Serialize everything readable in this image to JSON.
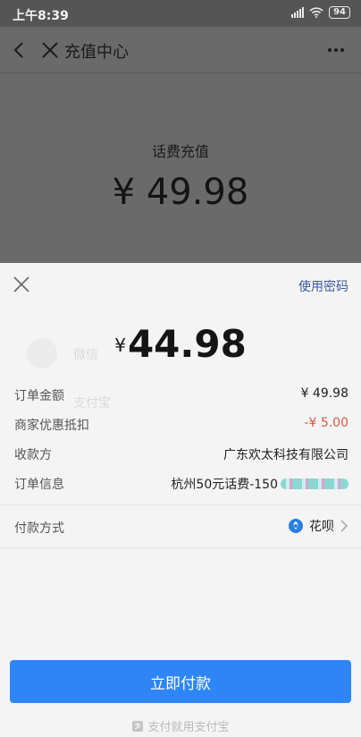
{
  "status_bar": {
    "time": "上午8:39",
    "battery": "94"
  },
  "nav": {
    "title": "充值中心"
  },
  "recharge": {
    "label": "话费充值",
    "amount": "¥ 49.98"
  },
  "sheet": {
    "use_password": "使用密码",
    "amount_currency": "¥",
    "amount_value": "44.98",
    "rows": [
      {
        "label": "订单金额",
        "value": "¥ 49.98"
      },
      {
        "label": "商家优惠抵扣",
        "value": "-¥ 5.00"
      },
      {
        "label": "收款方",
        "value": "广东欢太科技有限公司"
      },
      {
        "label": "订单信息",
        "value": "杭州50元话费-150"
      }
    ],
    "pay_method_label": "付款方式",
    "pay_method_value": "花呗",
    "pay_button": "立即付款",
    "footer": "支付就用支付宝"
  },
  "background_ghost": {
    "wechat_label": "微信",
    "alipay_label": "支付宝"
  },
  "colors": {
    "accent": "#2e86f6",
    "discount": "#e0573f",
    "link": "#3d5a9a"
  }
}
